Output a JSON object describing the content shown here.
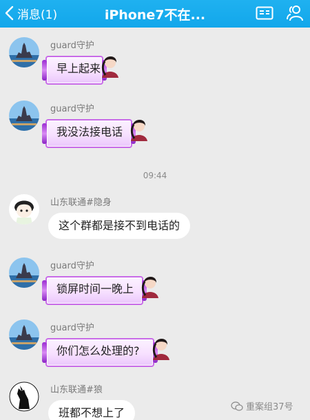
{
  "header": {
    "back_label": "消息(1)",
    "title": "iPhone7不在..."
  },
  "messages": [
    {
      "sender": "guard守护",
      "text": "早上起来"
    },
    {
      "sender": "guard守护",
      "text": "我没法接电话"
    },
    {
      "sender": "山东联通#隐身",
      "text": "这个群都是接不到电话的"
    },
    {
      "sender": "guard守护",
      "text": "锁屏时间一晚上"
    },
    {
      "sender": "guard守护",
      "text": "你们怎么处理的?"
    },
    {
      "sender": "山东联通#狼",
      "text": "班都不想上了"
    }
  ],
  "timestamp": "09:44",
  "watermark": "重案组37号",
  "colors": {
    "header": "#1fb1f0",
    "background": "#ebebeb",
    "bubble_frame": "#c86ae8"
  }
}
